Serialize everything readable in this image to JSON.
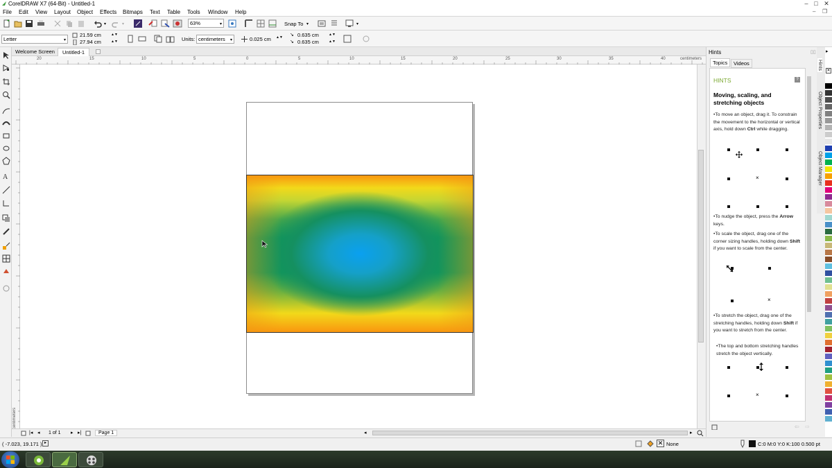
{
  "window": {
    "title": "CorelDRAW X7 (64-Bit) - Untitled-1"
  },
  "menu": [
    "File",
    "Edit",
    "View",
    "Layout",
    "Object",
    "Effects",
    "Bitmaps",
    "Text",
    "Table",
    "Tools",
    "Window",
    "Help"
  ],
  "toolbar": {
    "zoom": "63%",
    "snap_to": "Snap To"
  },
  "property_bar": {
    "paper": "Letter",
    "width": "21.59 cm",
    "height": "27.94 cm",
    "units_label": "Units:",
    "units_value": "centimeters",
    "nudge": "0.025 cm",
    "dup_x": "0.635 cm",
    "dup_y": "0.635 cm"
  },
  "tabs": [
    "Welcome Screen",
    "Untitled-1"
  ],
  "ruler": {
    "h_ticks": [
      "20",
      "15",
      "10",
      "5",
      "0",
      "5",
      "10",
      "15",
      "20",
      "25",
      "30",
      "35",
      "40"
    ],
    "h_unit": "centimeters",
    "v_unit": "centimeters"
  },
  "page_nav": {
    "count": "1 of 1",
    "page_tab": "Page 1"
  },
  "status": {
    "coords": "( -7.023, 19.171 )",
    "fill": "None",
    "outline": "C:0 M:0 Y:0 K:100  0.500 pt"
  },
  "docker": {
    "title": "Hints",
    "tabs": [
      "Topics",
      "Videos"
    ],
    "header": "HINTS",
    "heading": "Moving, scaling, and stretching objects",
    "p1_a": "To move an object, drag it. To constrain the movement to the horizontal or vertical axis, hold down ",
    "p1_key": "Ctrl",
    "p1_b": " while dragging.",
    "p2_a": "To nudge the object, press the ",
    "p2_key": "Arrow",
    "p2_b": " keys.",
    "p3_a": "To scale the object, drag one of the corner sizing handles, holding down ",
    "p3_key": "Shift",
    "p3_b": " if you want to scale from the center.",
    "p4_a": "To stretch the object, drag one of the stretching handles, holding down ",
    "p4_key": "Shift",
    "p4_b": " if you want to stretch from the center.",
    "p5": "The top and bottom stretching handles stretch the object vertically."
  },
  "side_tabs": [
    "Hints",
    "Object Properties",
    "Object Manager"
  ],
  "palette": [
    "#ffffff",
    "#000000",
    "#333333",
    "#4d4d4d",
    "#666666",
    "#808080",
    "#999999",
    "#b3b3b3",
    "#cccccc",
    "#e6e6e6",
    "#1e3fb0",
    "#00a0e8",
    "#00b050",
    "#f2e600",
    "#f7a100",
    "#e8301c",
    "#e0007a",
    "#8f2a8f",
    "#d88a9c",
    "#f5c6a0",
    "#a0d8d0",
    "#4a90c8",
    "#2a6a40",
    "#8ab84a",
    "#c8b878",
    "#b87848",
    "#884c28",
    "#60c0e0",
    "#3050a0",
    "#70c090",
    "#e0e090",
    "#f0a060",
    "#c04040",
    "#905090",
    "#5070b0",
    "#40a0a0",
    "#80c060",
    "#f0d040",
    "#e07030",
    "#a02030",
    "#6060c0",
    "#3090d0",
    "#20a080",
    "#a0c040",
    "#f0b030",
    "#e05040",
    "#c03070",
    "#8040a0",
    "#4060b0",
    "#60b0d0"
  ],
  "taskbar": {
    "icons": [
      "windows-start",
      "coreldraw-connect",
      "coreldraw-app",
      "media-app"
    ]
  }
}
